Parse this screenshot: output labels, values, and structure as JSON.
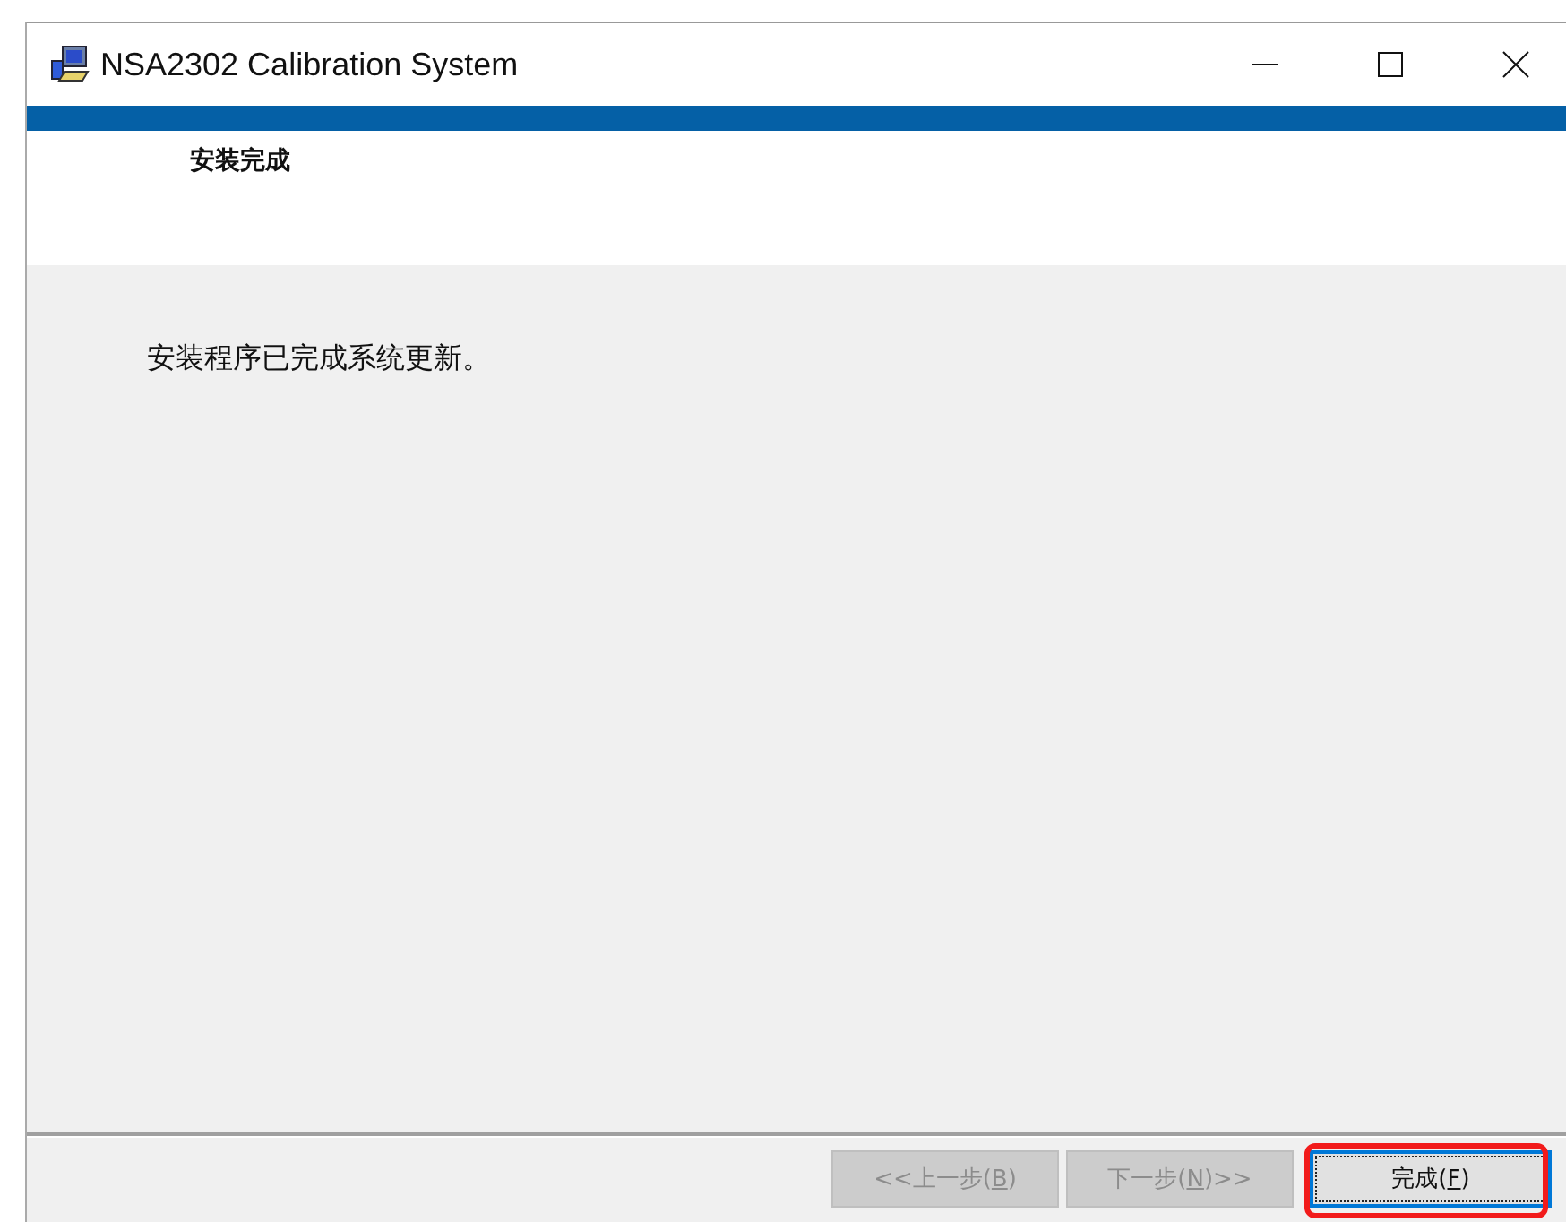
{
  "window": {
    "title": "NSA2302 Calibration System"
  },
  "header": {
    "title": "安装完成"
  },
  "body": {
    "message": "安装程序已完成系统更新。"
  },
  "buttons": [
    {
      "before": "<<上一步(",
      "key": "B",
      "after": ")",
      "disabled": true,
      "focused": false,
      "highlighted": false
    },
    {
      "before": "下一步(",
      "key": "N",
      "after": ")>>",
      "disabled": true,
      "focused": false,
      "highlighted": false
    },
    {
      "before": "完成(",
      "key": "F",
      "after": ")",
      "disabled": false,
      "focused": true,
      "highlighted": true
    }
  ]
}
